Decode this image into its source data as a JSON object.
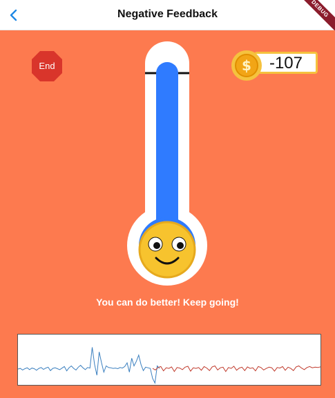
{
  "header": {
    "title": "Negative Feedback",
    "back_icon": "chevron-left-icon",
    "debug_label": "DEBUG"
  },
  "colors": {
    "background": "#fd7a4f",
    "mercury": "#2f7bff",
    "stop_sign": "#d9352b",
    "coin": "#f5b72a",
    "accent_blue": "#1e88e5"
  },
  "controls": {
    "end_label": "End",
    "end_icon": "stop-sign-icon"
  },
  "score": {
    "coin_icon": "dollar-coin-icon",
    "value": "-107"
  },
  "thermometer": {
    "level_percent": 100,
    "bulb_icon": "smiley-face-icon"
  },
  "feedback": {
    "message": "You can do better! Keep going!"
  },
  "signal": {
    "blue_series": [
      0,
      0.02,
      -0.03,
      0.01,
      0.04,
      -0.02,
      0.03,
      0.01,
      -0.04,
      0.02,
      0.05,
      -0.01,
      0.03,
      0.06,
      -0.05,
      0.02,
      0.04,
      0.01,
      -0.02,
      0.03,
      0.08,
      -0.06,
      0.04,
      0.1,
      0.02,
      -0.03,
      0.06,
      0.12,
      0.04,
      -0.02,
      0.05,
      0.03,
      0.7,
      0.15,
      -0.2,
      0.55,
      0.2,
      -0.1,
      0.1,
      0.05,
      0.04,
      0.02,
      0.03,
      0.01,
      0.05,
      0.03,
      0.08,
      0.2,
      -0.1,
      0.35,
      0.1,
      0.25,
      0.45,
      0.15,
      -0.05,
      0.06,
      0.04,
      0.02,
      -0.3,
      -0.45,
      0.1,
      0.02
    ],
    "red_series": [
      0.02,
      -0.03,
      0.05,
      0.08,
      -0.06,
      0.04,
      0.02,
      0.07,
      -0.08,
      0.05,
      0.03,
      -0.02,
      0.06,
      0.09,
      -0.07,
      0.04,
      0.02,
      0.05,
      -0.04,
      0.08,
      0.03,
      -0.05,
      0.07,
      0.1,
      -0.03,
      0.04,
      0.06,
      -0.08,
      0.05,
      0.02,
      0.09,
      -0.04,
      0.03,
      0.06,
      -0.05,
      0.07,
      0.02,
      0.04,
      -0.06,
      0.08,
      0.05,
      -0.03,
      0.02,
      0.06,
      0.04,
      -0.07,
      0.05,
      0.03,
      0.08,
      -0.04,
      0.06,
      0.02,
      -0.05,
      0.07,
      0.1,
      0.03,
      -0.02,
      0.05,
      0.08,
      0.04,
      0.06,
      0.05,
      0.07
    ]
  }
}
